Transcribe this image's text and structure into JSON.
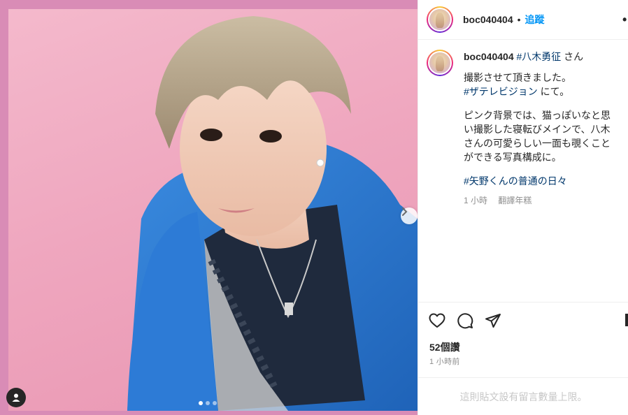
{
  "post": {
    "username": "boc040404",
    "separator": "•",
    "follow_label": "追蹤",
    "more_icon": "more-horizontal-icon"
  },
  "caption": {
    "username": "boc040404",
    "tag_person": "#八木勇征",
    "line1_suffix": " さん",
    "line2": "撮影させて頂きました。",
    "tag_tv": "#ザテレビジョン",
    "line3_suffix": " にて。",
    "paragraph2": "ピンク背景では、猫っぽいなと思い撮影した寝転びメインで、八木さんの可愛らしい一面も覗くことができる写真構成に。",
    "tag_series": "#矢野くんの普通の日々"
  },
  "meta": {
    "time_ago": "1 小時",
    "translate_label": "翻譯年糕"
  },
  "actions": {
    "like_icon": "heart-icon",
    "comment_icon": "comment-icon",
    "share_icon": "send-icon",
    "save_icon": "bookmark-icon"
  },
  "stats": {
    "likes": "52個讚",
    "posted": "1 小時前"
  },
  "comments_notice": "這則貼文設有留言數量上限。",
  "carousel": {
    "total": 3,
    "active_index": 0
  },
  "colors": {
    "accent": "#0095f6",
    "hashtag": "#00376b",
    "photo_background": "#efa7bf",
    "frame": "#d98cb6",
    "jacket": "#2f7fd1"
  }
}
